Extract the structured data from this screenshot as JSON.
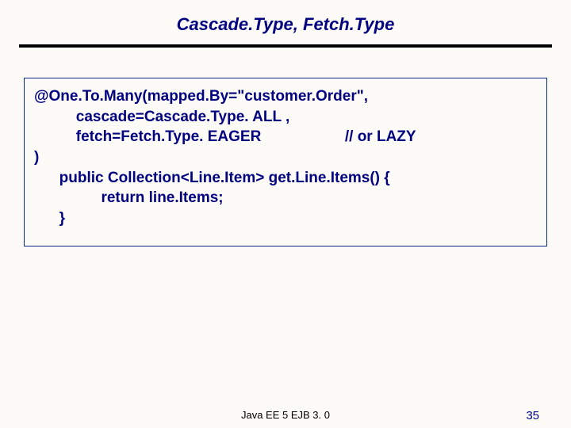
{
  "title": "Cascade.Type, Fetch.Type",
  "code": {
    "line1": "@One.To.Many(mapped.By=\"customer.Order\",",
    "line2": "          cascade=Cascade.Type. ALL ,",
    "line3": "          fetch=Fetch.Type. EAGER                    // or LAZY",
    "line4": ")",
    "line5": "      public Collection<Line.Item> get.Line.Items() {",
    "line6": "                return line.Items;",
    "line7": "      }"
  },
  "footer": {
    "center": "Java EE 5 EJB 3. 0",
    "page": "35"
  }
}
